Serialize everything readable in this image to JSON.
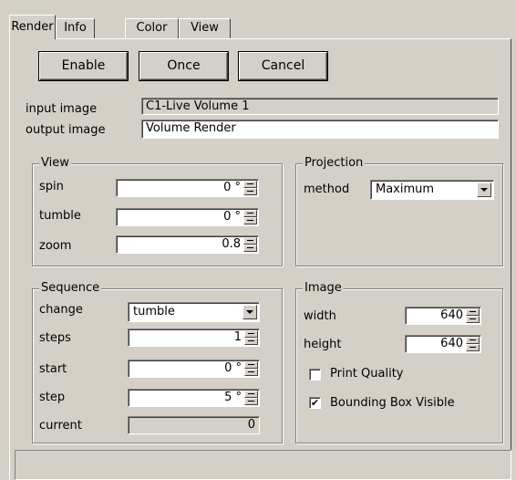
{
  "tabs": [
    {
      "label": "Render"
    },
    {
      "label": "Info"
    },
    {
      "label": "Color"
    },
    {
      "label": "View"
    }
  ],
  "buttons": {
    "enable": "Enable",
    "once": "Once",
    "cancel": "Cancel"
  },
  "io": {
    "input_label": "input  image",
    "input_value": "C1-Live Volume 1",
    "output_label": "output image",
    "output_value": "Volume Render"
  },
  "view_group": {
    "title": "View",
    "spin_label": "spin",
    "spin_value": "0 °",
    "tumble_label": "tumble",
    "tumble_value": "0 °",
    "zoom_label": "zoom",
    "zoom_value": "0.8"
  },
  "projection_group": {
    "title": "Projection",
    "method_label": "method",
    "method_value": "Maximum"
  },
  "sequence_group": {
    "title": "Sequence",
    "change_label": "change",
    "change_value": "tumble",
    "steps_label": "steps",
    "steps_value": "1",
    "start_label": "start",
    "start_value": "0 °",
    "step_label": "step",
    "step_value": "5 °",
    "current_label": "current",
    "current_value": "0"
  },
  "image_group": {
    "title": "Image",
    "width_label": "width",
    "width_value": "640",
    "height_label": "height",
    "height_value": "640",
    "print_quality_label": "Print Quality",
    "print_quality_checked": false,
    "bounding_box_label": "Bounding Box Visible",
    "bounding_box_checked": true
  }
}
